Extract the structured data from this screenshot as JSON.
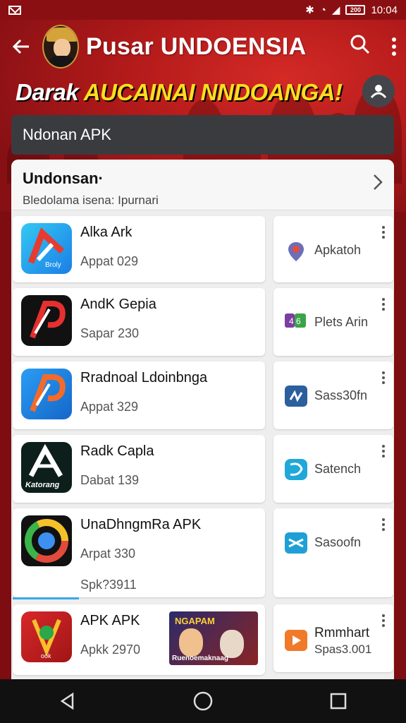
{
  "status_bar": {
    "time": "10:04",
    "battery": "200"
  },
  "header": {
    "title": "Pusar UNDOENSIA"
  },
  "banner": {
    "part1": "Darak ",
    "part2": "AUCAINAI NNDOANGA!"
  },
  "search": {
    "value": "Ndonan APK"
  },
  "section": {
    "title": "Undonsan·",
    "subtitle": "Bledolama isena: Ipurnari"
  },
  "apps": [
    {
      "name": "Alka Ark",
      "meta": "Appat 029"
    },
    {
      "name": "AndK Gepia",
      "meta": "Sapar 230"
    },
    {
      "name": "Rradnoal Ldoinbnga",
      "meta": "Appat 329"
    },
    {
      "name": "Radk Capla",
      "meta": "Dabat 139"
    },
    {
      "name": "UnaDhngmRa APK",
      "meta": "Arpat 330",
      "extra": "Spk?3911"
    },
    {
      "name": "APK APK",
      "meta": "Apkk 2970"
    }
  ],
  "side_items": [
    {
      "label": "Apkatoh"
    },
    {
      "label": "Plets Arin"
    },
    {
      "label": "Sass30fn"
    },
    {
      "label": "Satench"
    },
    {
      "label": "Sasoofn"
    },
    {
      "label": "Rmmhart",
      "meta": "Spas3.001"
    }
  ],
  "promo": {
    "title": "NGAPAM",
    "subtitle": "Ruenoemaknaag"
  },
  "colors": {
    "accent": "#b21a1a",
    "banner_yellow": "#ffdd1f",
    "panel": "#eeeeee"
  }
}
